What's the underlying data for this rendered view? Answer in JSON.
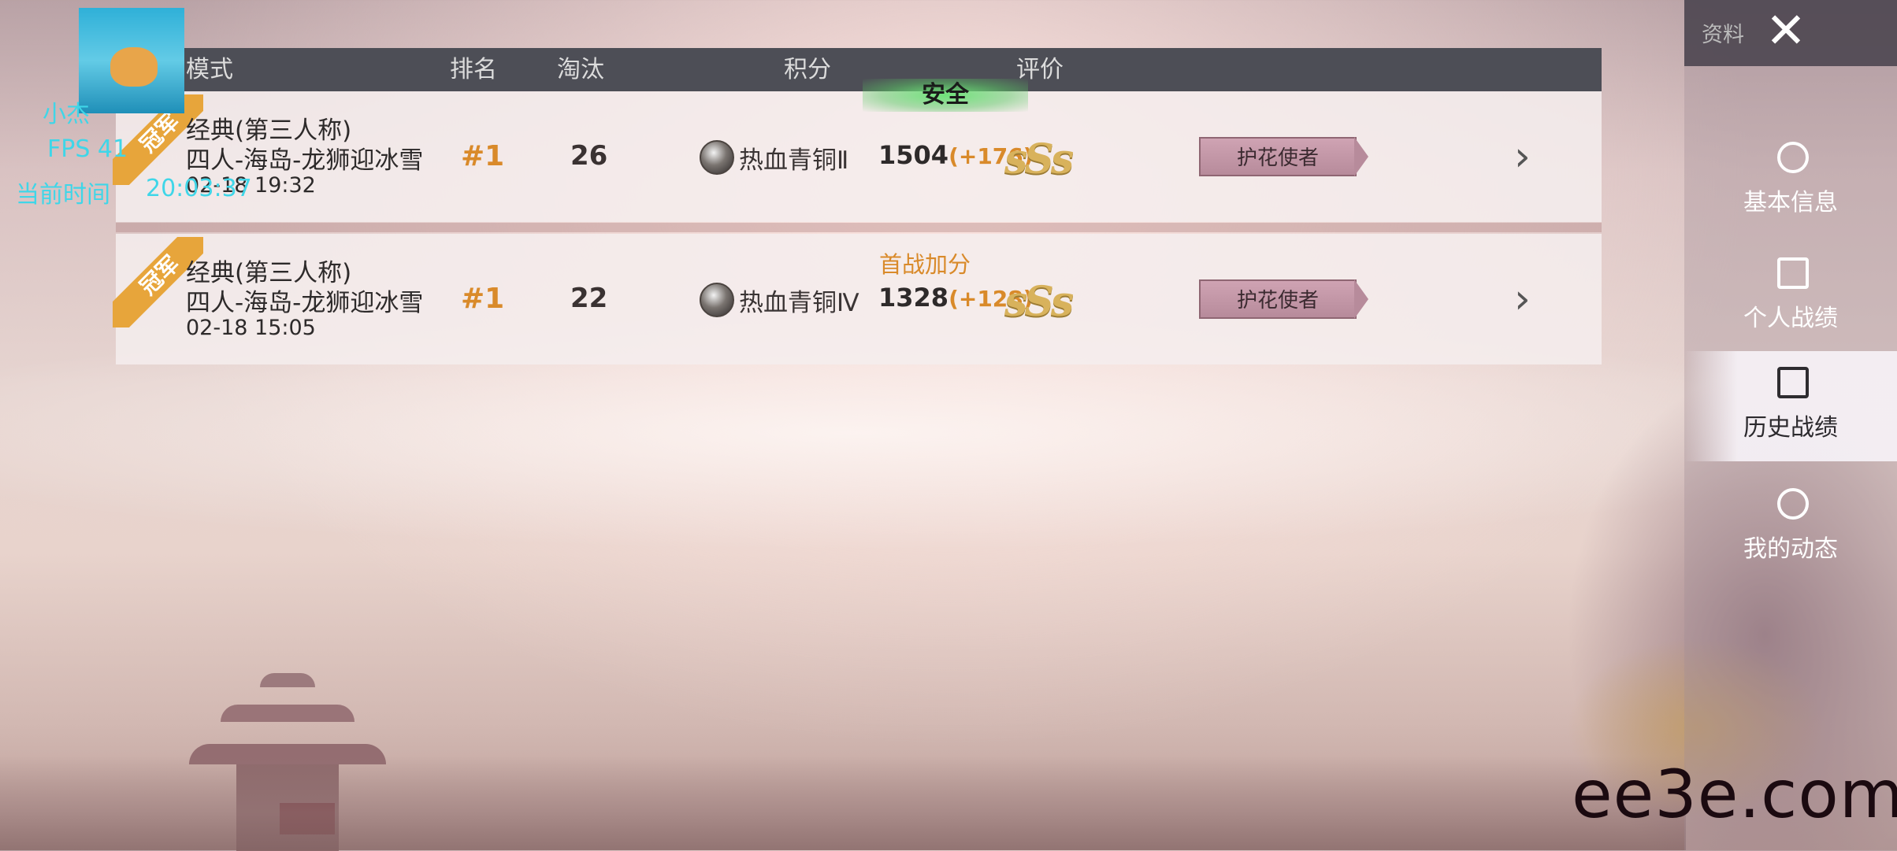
{
  "header": {
    "mode": "模式",
    "rank": "排名",
    "kills": "淘汰",
    "score": "积分",
    "rating": "评价"
  },
  "rows": [
    {
      "ribbon": "冠军",
      "mode": "经典(第三人称)",
      "map": "四人-海岛-龙狮迎冰雪",
      "time": "02-18 19:32",
      "rank": "#1",
      "kills": "26",
      "tier": "热血青铜Ⅱ",
      "score": "1504",
      "delta": "(+176)",
      "grade": "sSs",
      "badge": "护花使者"
    },
    {
      "ribbon": "冠军",
      "mode": "经典(第三人称)",
      "map": "四人-海岛-龙狮迎冰雪",
      "time": "02-18 15:05",
      "rank": "#1",
      "kills": "22",
      "tier": "热血青铜Ⅳ",
      "score": "1328",
      "delta": "(+128)",
      "grade": "sSs",
      "badge": "护花使者"
    }
  ],
  "tags": {
    "safe": "安全",
    "first_bonus": "首战加分"
  },
  "sidebar": {
    "title": "资料",
    "close": "✕",
    "items": [
      {
        "label": "基本信息",
        "icon": "user-hex-icon"
      },
      {
        "label": "个人战绩",
        "icon": "chart-doc-icon"
      },
      {
        "label": "历史战绩",
        "icon": "history-doc-icon",
        "active": true
      },
      {
        "label": "我的动态",
        "icon": "user-circle-icon"
      }
    ]
  },
  "overlay": {
    "user": "小杰",
    "fps": "FPS 41",
    "time_label": "当前时间",
    "time_value": "20:03:37"
  },
  "watermark": "ee3e.com"
}
